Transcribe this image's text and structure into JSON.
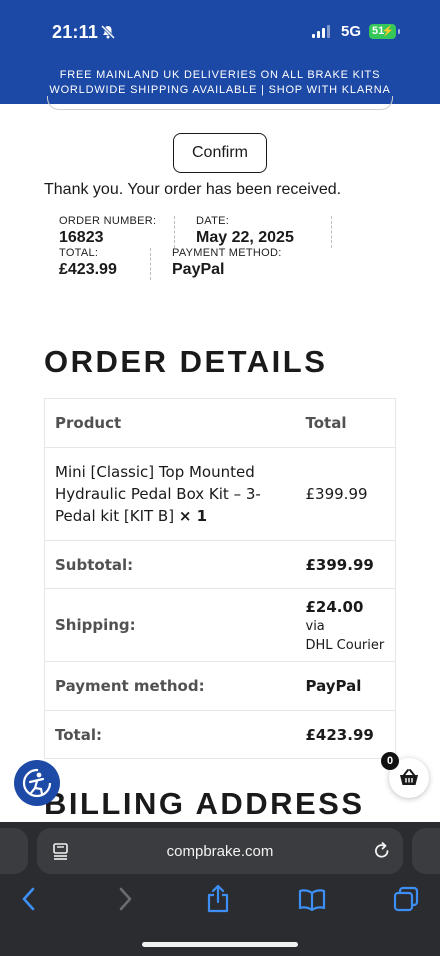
{
  "status_bar": {
    "time": "21:11",
    "network": "5G",
    "battery": "51"
  },
  "banner": {
    "line1": "FREE MAINLAND UK DELIVERIES ON ALL BRAKE KITS",
    "line2": "WORLDWIDE SHIPPING AVAILABLE | SHOP WITH KLARNA"
  },
  "page": {
    "confirm_label": "Confirm",
    "thank_you": "Thank you. Your order has been received."
  },
  "overview": {
    "order_number_label": "ORDER NUMBER:",
    "order_number": "16823",
    "date_label": "DATE:",
    "date": "May 22, 2025",
    "total_label": "TOTAL:",
    "total": "£423.99",
    "payment_label": "PAYMENT METHOD:",
    "payment": "PayPal"
  },
  "order_details": {
    "title": "ORDER DETAILS",
    "header_product": "Product",
    "header_total": "Total",
    "item_name": "Mini [Classic] Top Mounted Hydraulic Pedal Box Kit – 3-Pedal kit [KIT B]",
    "item_qty": "× 1",
    "item_price": "£399.99",
    "subtotal_label": "Subtotal:",
    "subtotal": "£399.99",
    "shipping_label": "Shipping:",
    "shipping_amount": "£24.00",
    "shipping_via": "via",
    "shipping_courier": "DHL Courier",
    "payment_label": "Payment method:",
    "payment": "PayPal",
    "total_label": "Total:",
    "total": "£423.99"
  },
  "billing": {
    "title": "BILLING ADDRESS"
  },
  "cart": {
    "count": "0"
  },
  "browser": {
    "url": "compbrake.com"
  },
  "colors": {
    "brand_blue": "#1c48a6",
    "battery_green": "#35c759",
    "toolbar_bg": "#2b2c2f",
    "toolbar_accent": "#3d8ff5"
  }
}
